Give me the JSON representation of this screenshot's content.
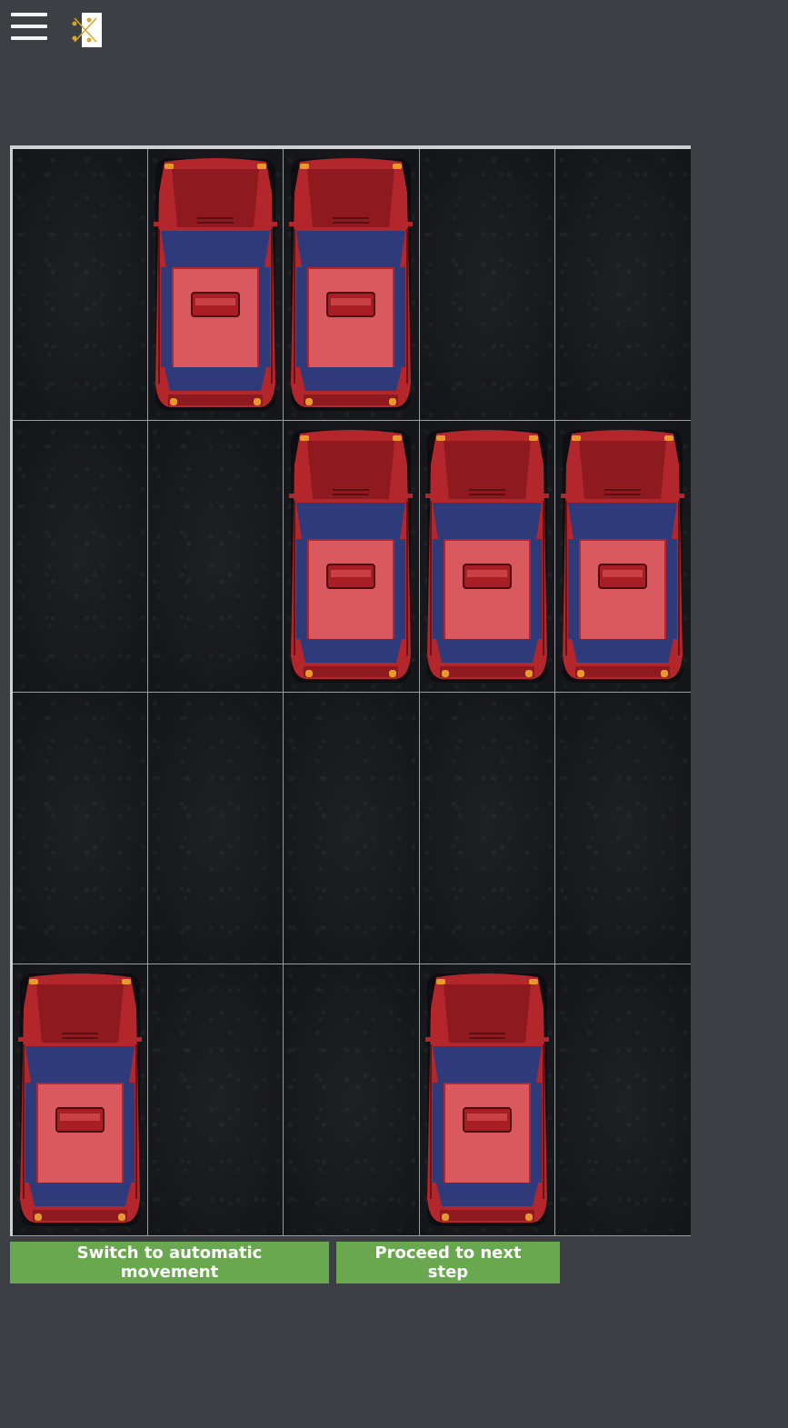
{
  "header": {
    "menu_icon": "hamburger-menu-icon",
    "logo_icon": "crossing-paths-logo-icon"
  },
  "board": {
    "rows": 4,
    "columns": 5,
    "cars": [
      {
        "row": 0,
        "col": 1
      },
      {
        "row": 0,
        "col": 2
      },
      {
        "row": 1,
        "col": 2
      },
      {
        "row": 1,
        "col": 3
      },
      {
        "row": 1,
        "col": 4
      },
      {
        "row": 3,
        "col": 0
      },
      {
        "row": 3,
        "col": 3
      }
    ],
    "car_icon": "red-car-top-view-icon"
  },
  "controls": {
    "auto_label": "Switch to automatic movement",
    "next_label": "Proceed to next step"
  },
  "colors": {
    "background": "#3c3f43",
    "button": "#6aa84f",
    "car_body": "#b3262c",
    "car_window": "#2e3a7a"
  }
}
